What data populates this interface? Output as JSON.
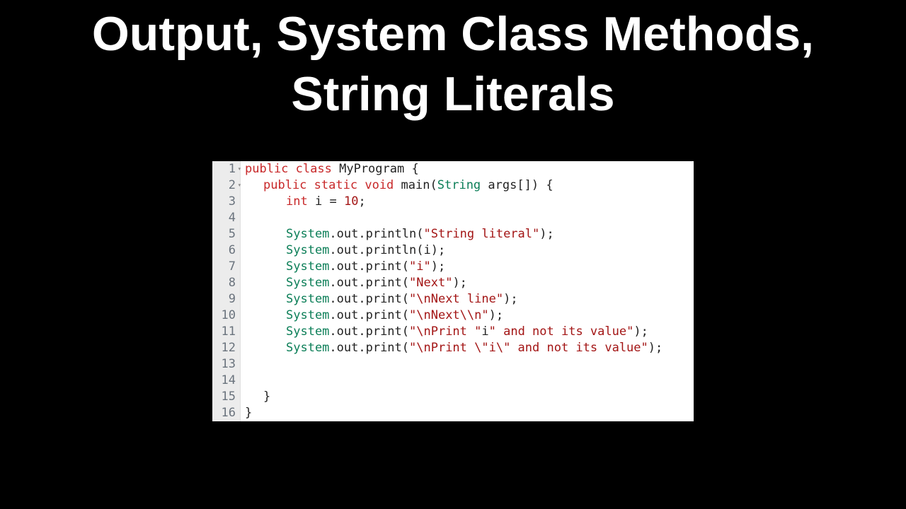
{
  "title_line1": "Output, System Class Methods,",
  "title_line2": "String Literals",
  "gutter": [
    "1",
    "2",
    "3",
    "4",
    "5",
    "6",
    "7",
    "8",
    "9",
    "10",
    "11",
    "12",
    "13",
    "14",
    "15",
    "16"
  ],
  "code": {
    "l1": {
      "a": "public",
      "b": "class",
      "c": "MyProgram",
      "d": "{"
    },
    "l2": {
      "a": "public",
      "b": "static",
      "c": "void",
      "d": "main",
      "e": "(",
      "f": "String",
      "g": "args[]",
      "h": ") {"
    },
    "l3": {
      "a": "int",
      "b": "i",
      "c": "=",
      "d": "10",
      "e": ";"
    },
    "l5": {
      "a": "System",
      "b": ".out.println(",
      "c": "\"String literal\"",
      "d": ");"
    },
    "l6": {
      "a": "System",
      "b": ".out.println(i);"
    },
    "l7": {
      "a": "System",
      "b": ".out.print(",
      "c": "\"i\"",
      "d": ");"
    },
    "l8": {
      "a": "System",
      "b": ".out.print(",
      "c": "\"Next\"",
      "d": ");"
    },
    "l9": {
      "a": "System",
      "b": ".out.print(",
      "c": "\"\\nNext line\"",
      "d": ");"
    },
    "l10": {
      "a": "System",
      "b": ".out.print(",
      "c": "\"\\nNext\\\\n\"",
      "d": ");"
    },
    "l11": {
      "a": "System",
      "b": ".out.print(",
      "c": "\"\\nPrint \"",
      "d": "i",
      "e": "\" and not its value\"",
      "f": ");"
    },
    "l12": {
      "a": "System",
      "b": ".out.print(",
      "c": "\"\\nPrint \\\"i\\\" and not its value\"",
      "d": ");"
    },
    "l15": {
      "a": "}"
    },
    "l16": {
      "a": "}"
    }
  }
}
